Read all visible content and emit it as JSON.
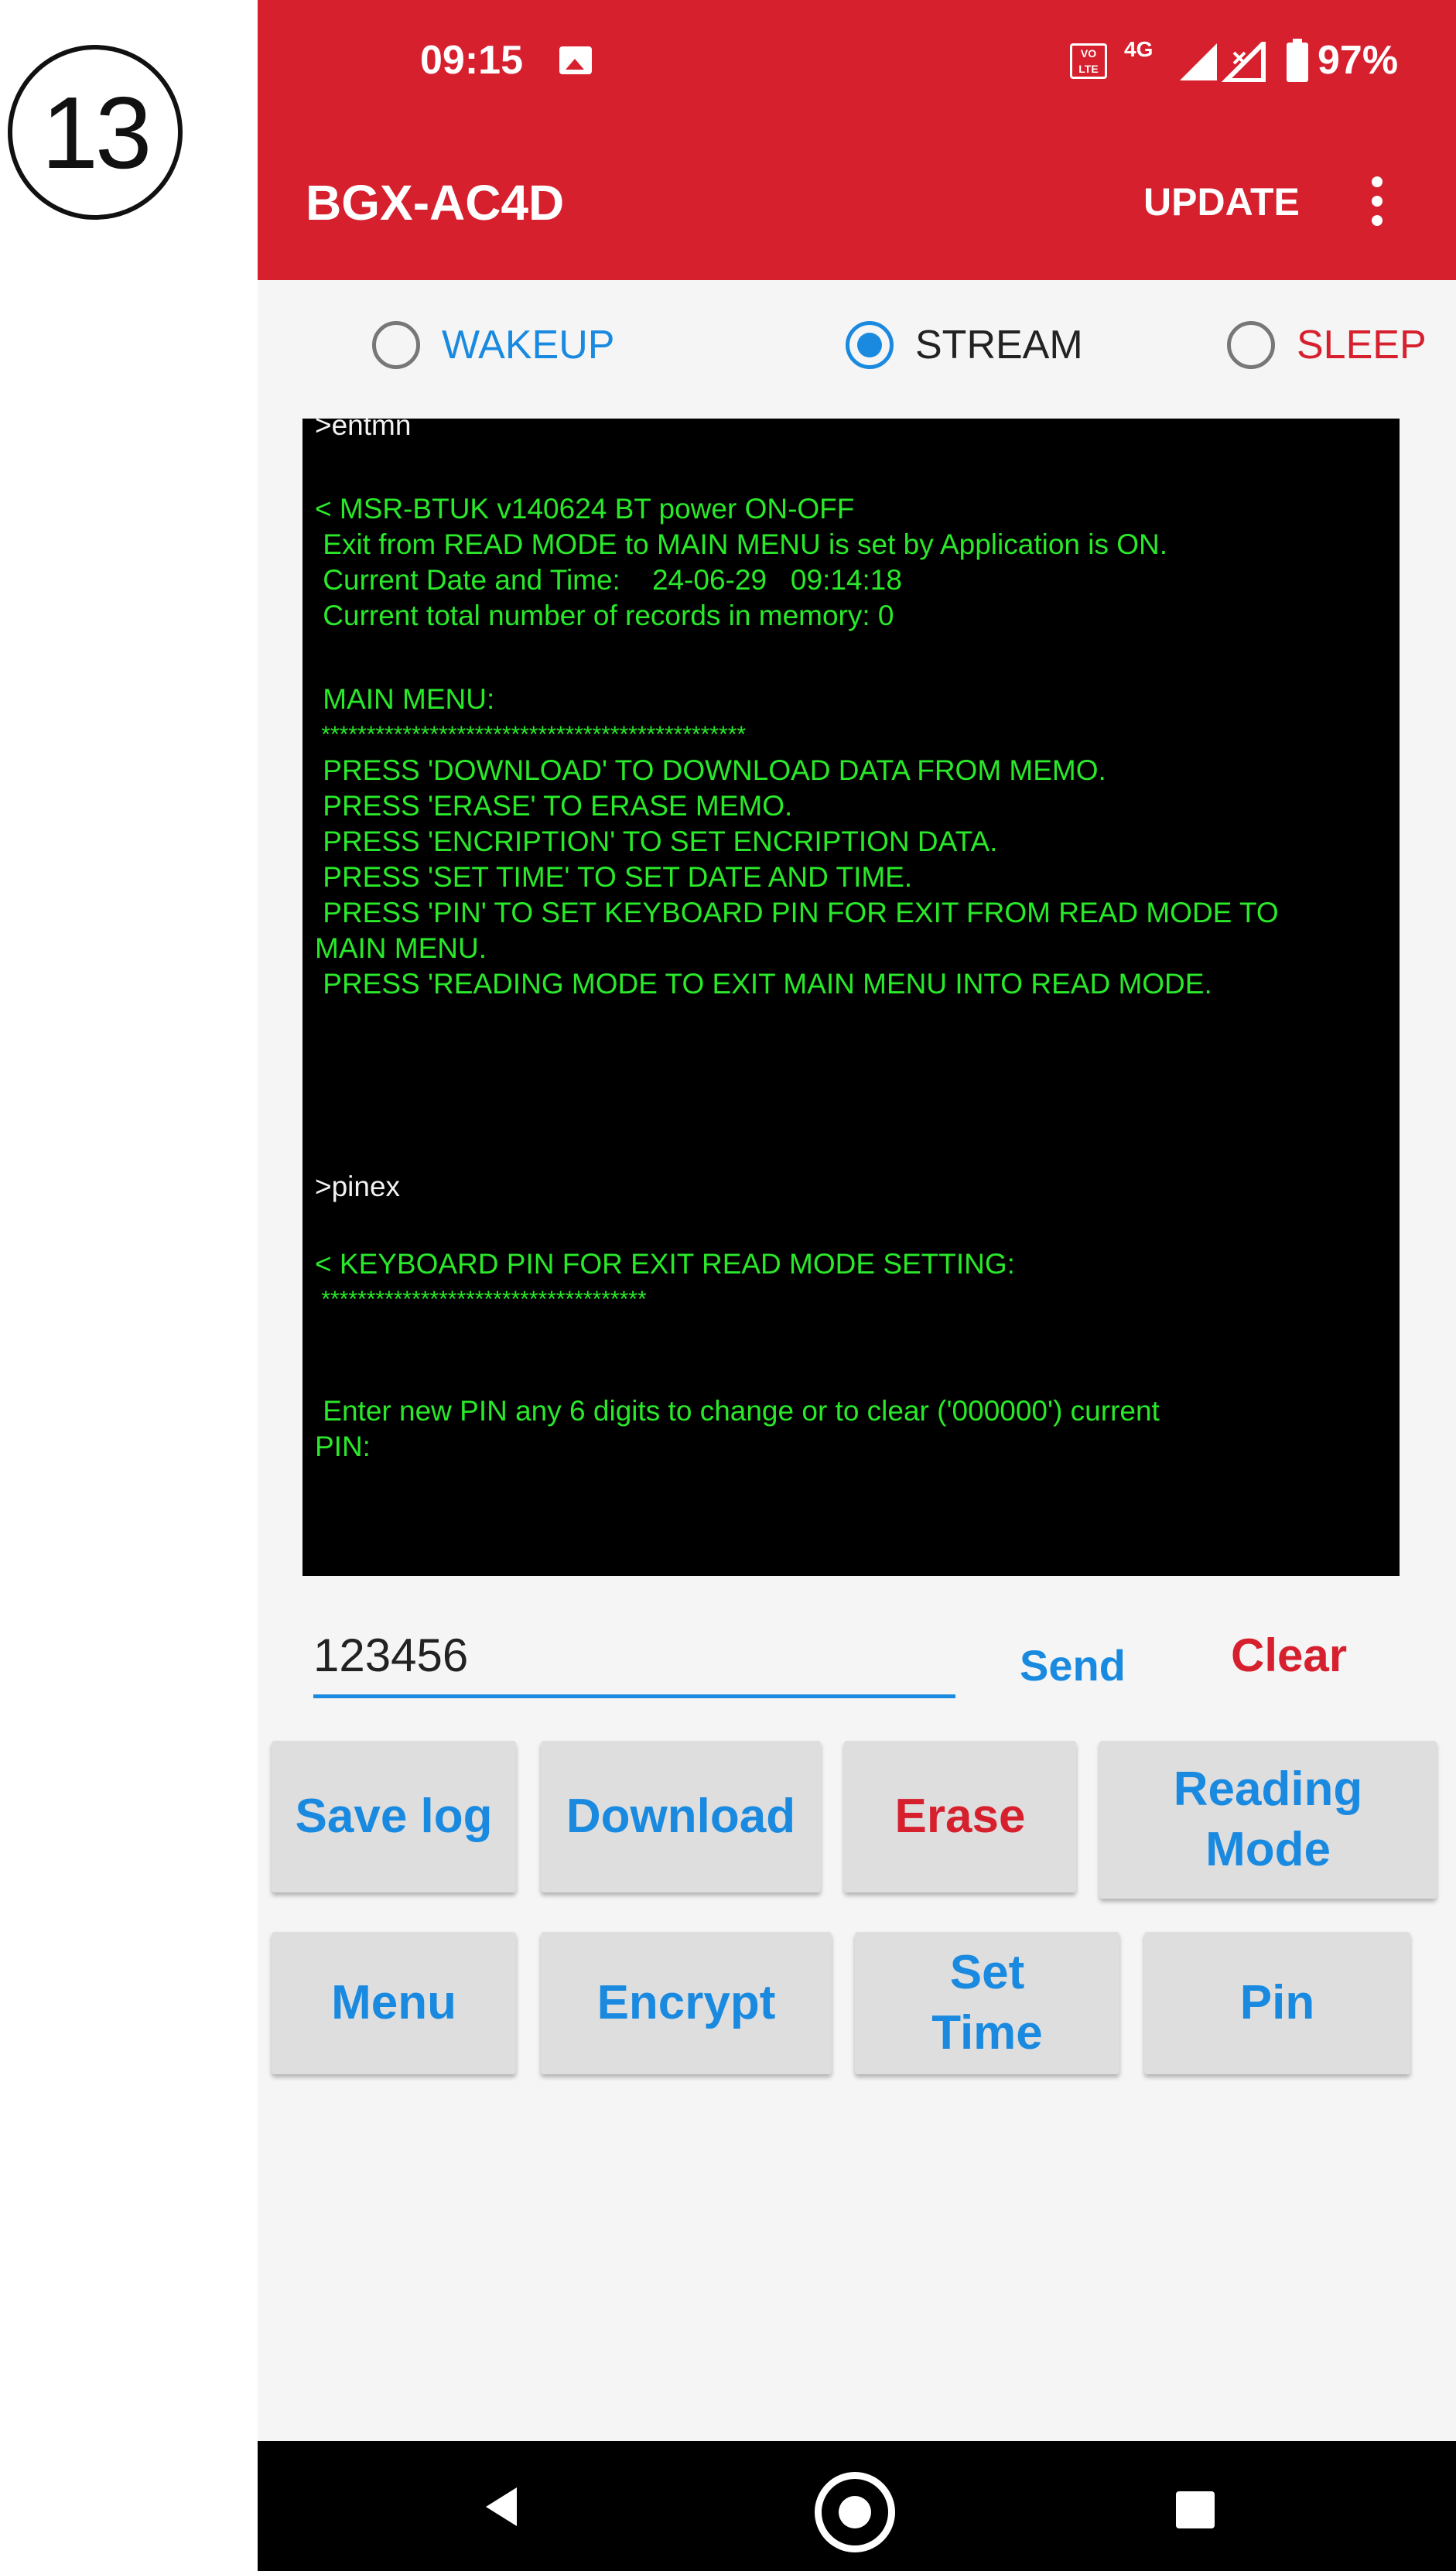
{
  "step_number": "13",
  "status_bar": {
    "time": "09:15",
    "network": "4G",
    "volte": "VO LTE",
    "battery": "97%"
  },
  "app_bar": {
    "title": "BGX-AC4D",
    "update_label": "UPDATE"
  },
  "mode_radios": [
    {
      "label": "WAKEUP",
      "checked": false,
      "color": "#1a8ae0"
    },
    {
      "label": "STREAM",
      "checked": true,
      "color": "#222222"
    },
    {
      "label": "SLEEP",
      "checked": false,
      "color": "#d6202e"
    }
  ],
  "terminal": {
    "lines": [
      {
        "text": ">entmn",
        "color": "white"
      },
      {
        "text": "< MSR-BTUK v140624 BT power ON-OFF",
        "color": "green"
      },
      {
        "text": " Exit from READ MODE to MAIN MENU is set by Application is ON.",
        "color": "green"
      },
      {
        "text": " Current Date and Time:    24-06-29   09:14:18",
        "color": "green"
      },
      {
        "text": " Current total number of records in memory: 0",
        "color": "green"
      },
      {
        "text": " MAIN MENU:",
        "color": "green"
      },
      {
        "text": " ***********************************************",
        "color": "green"
      },
      {
        "text": " PRESS 'DOWNLOAD' TO DOWNLOAD DATA FROM MEMO.",
        "color": "green"
      },
      {
        "text": " PRESS 'ERASE' TO ERASE MEMO.",
        "color": "green"
      },
      {
        "text": " PRESS 'ENCRIPTION' TO SET ENCRIPTION DATA.",
        "color": "green"
      },
      {
        "text": " PRESS 'SET TIME' TO SET DATE AND TIME.",
        "color": "green"
      },
      {
        "text": " PRESS 'PIN' TO SET KEYBOARD PIN FOR EXIT FROM READ MODE TO",
        "color": "green"
      },
      {
        "text": "MAIN MENU.",
        "color": "green"
      },
      {
        "text": " PRESS 'READING MODE TO EXIT MAIN MENU INTO READ MODE.",
        "color": "green"
      },
      {
        "text": ">pinex",
        "color": "white"
      },
      {
        "text": "< KEYBOARD PIN FOR EXIT READ MODE SETTING:",
        "color": "green"
      },
      {
        "text": " ************************************",
        "color": "green"
      },
      {
        "text": " Enter new PIN any 6 digits to change or to clear ('000000') current",
        "color": "green"
      },
      {
        "text": "PIN:",
        "color": "green"
      }
    ]
  },
  "input": {
    "value": "123456"
  },
  "send_label": "Send",
  "clear_label": "Clear",
  "buttons_row1": [
    {
      "label": "Save log",
      "color": "blue"
    },
    {
      "label": "Download",
      "color": "blue"
    },
    {
      "label": "Erase",
      "color": "red"
    },
    {
      "label": "Reading\nMode",
      "color": "blue"
    }
  ],
  "buttons_row2": [
    {
      "label": "Menu",
      "color": "blue"
    },
    {
      "label": "Encrypt",
      "color": "blue"
    },
    {
      "label": "Set\nTime",
      "color": "blue"
    },
    {
      "label": "Pin",
      "color": "blue"
    }
  ],
  "nav_icons": [
    "back-icon",
    "home-icon",
    "recent-apps-icon"
  ]
}
